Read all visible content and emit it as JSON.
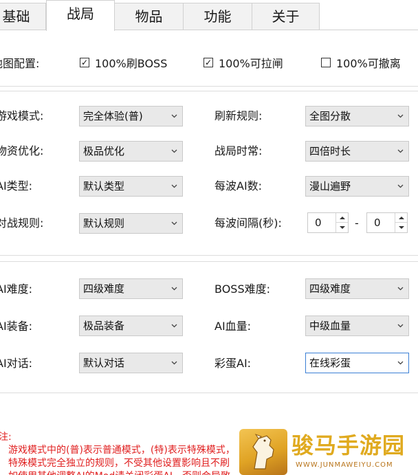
{
  "tabs": [
    {
      "label": "基础"
    },
    {
      "label": "战局"
    },
    {
      "label": "物品"
    },
    {
      "label": "功能"
    },
    {
      "label": "关于"
    }
  ],
  "active_tab": "战局",
  "map_config": {
    "label": "地图配置:",
    "options": [
      {
        "label": "100%刷BOSS",
        "checked": true,
        "mark": "✓"
      },
      {
        "label": "100%可拉闸",
        "checked": true,
        "mark": "✓"
      },
      {
        "label": "100%可撤离",
        "checked": false,
        "mark": ""
      }
    ]
  },
  "section1": {
    "game_mode": {
      "label": "游戏模式:",
      "value": "完全体验(普)"
    },
    "refresh_rule": {
      "label": "刷新规则:",
      "value": "全图分散"
    },
    "supply_opt": {
      "label": "物资优化:",
      "value": "极品优化"
    },
    "match_time": {
      "label": "战局时常:",
      "value": "四倍时长"
    },
    "ai_type": {
      "label": "AI类型:",
      "value": "默认类型"
    },
    "ai_per_wave": {
      "label": "每波AI数:",
      "value": "漫山遍野"
    },
    "battle_rule": {
      "label": "对战规则:",
      "value": "默认规则"
    },
    "wave_interval": {
      "label": "每波间隔(秒):",
      "min": "0",
      "max": "0",
      "dash": "-"
    }
  },
  "section2": {
    "ai_difficulty": {
      "label": "AI难度:",
      "value": "四级难度"
    },
    "boss_difficulty": {
      "label": "BOSS难度:",
      "value": "四级难度"
    },
    "ai_equipment": {
      "label": "AI装备:",
      "value": "极品装备"
    },
    "ai_health": {
      "label": "AI血量:",
      "value": "中级血量"
    },
    "ai_dialogue": {
      "label": "AI对话:",
      "value": "默认对话"
    },
    "easter_egg_ai": {
      "label": "彩蛋AI:",
      "value": "在线彩蛋"
    }
  },
  "notes": {
    "title": "注:",
    "lines": [
      "游戏模式中的(普)表示普通模式，(特)表示特殊模式，",
      "特殊模式完全独立的规则，不受其他设置影响且不刷",
      "如使用其他调整AI的Mod请关闭彩蛋AI，否则会导致"
    ]
  },
  "watermark": {
    "name": "骏马手游园",
    "url": "WWW.JUNMAWEIYU.COM"
  },
  "colors": {
    "accent_focus": "#3a7fd5",
    "note_red": "#e02020",
    "watermark_gold": "#e0aa1f"
  }
}
